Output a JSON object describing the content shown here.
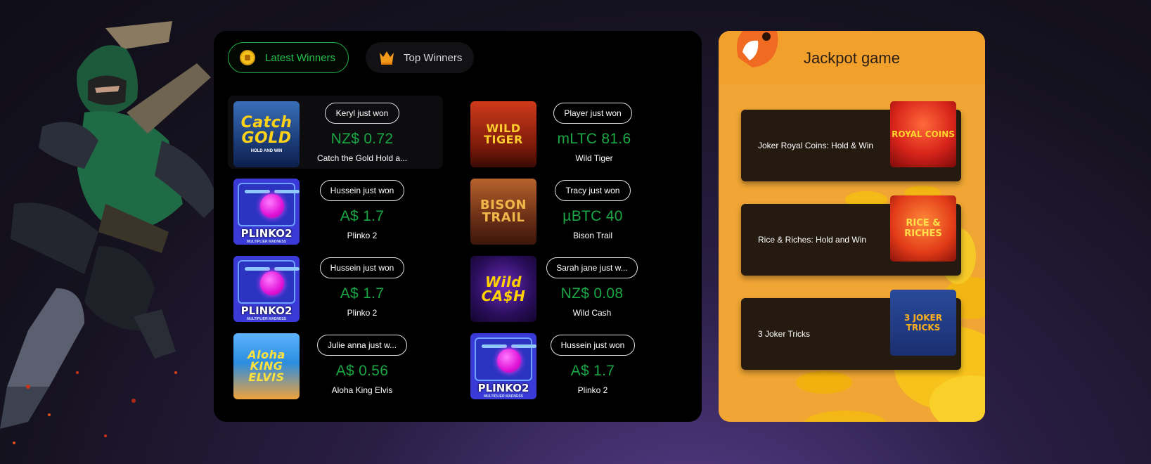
{
  "tabs": {
    "latest": "Latest Winners",
    "top": "Top Winners"
  },
  "winners": [
    {
      "pill": "Keryl just won",
      "amount": "NZ$ 0.72",
      "game": "Catch the Gold Hold a...",
      "thumb_text": "Catch GOLD",
      "thumb_sub": "HOLD AND WIN"
    },
    {
      "pill": "Player just won",
      "amount": "mLTC 81.6",
      "game": "Wild Tiger",
      "thumb_text": "WILD TIGER"
    },
    {
      "pill": "Hussein just won",
      "amount": "A$ 1.7",
      "game": "Plinko 2",
      "thumb_text": "PLINKO2",
      "thumb_sub": "MULTIPLIER MADNESS"
    },
    {
      "pill": "Tracy just won",
      "amount": "µBTC 40",
      "game": "Bison Trail",
      "thumb_text": "BISON TRAIL"
    },
    {
      "pill": "Hussein just won",
      "amount": "A$ 1.7",
      "game": "Plinko 2",
      "thumb_text": "PLINKO2",
      "thumb_sub": "MULTIPLIER MADNESS"
    },
    {
      "pill": "Sarah jane just w...",
      "amount": "NZ$ 0.08",
      "game": "Wild Cash",
      "thumb_text": "Wild CA$H"
    },
    {
      "pill": "Julie anna just w...",
      "amount": "A$ 0.56",
      "game": "Aloha King Elvis",
      "thumb_text": "Aloha KING ELVIS"
    },
    {
      "pill": "Hussein just won",
      "amount": "A$ 1.7",
      "game": "Plinko 2",
      "thumb_text": "PLINKO2",
      "thumb_sub": "MULTIPLIER MADNESS"
    }
  ],
  "jackpot": {
    "title": "Jackpot game",
    "games": [
      {
        "name": "Joker Royal Coins: Hold & Win",
        "thumb_text": "ROYAL COINS"
      },
      {
        "name": "Rice & Riches: Hold and Win",
        "thumb_text": "RICE & RICHES"
      },
      {
        "name": "3 Joker Tricks",
        "thumb_text": "3 JOKER TRICKS"
      }
    ]
  },
  "colors": {
    "win_amount": "#1aa745",
    "active_tab": "#24c24e",
    "jackpot_bg": "#f0a534"
  }
}
